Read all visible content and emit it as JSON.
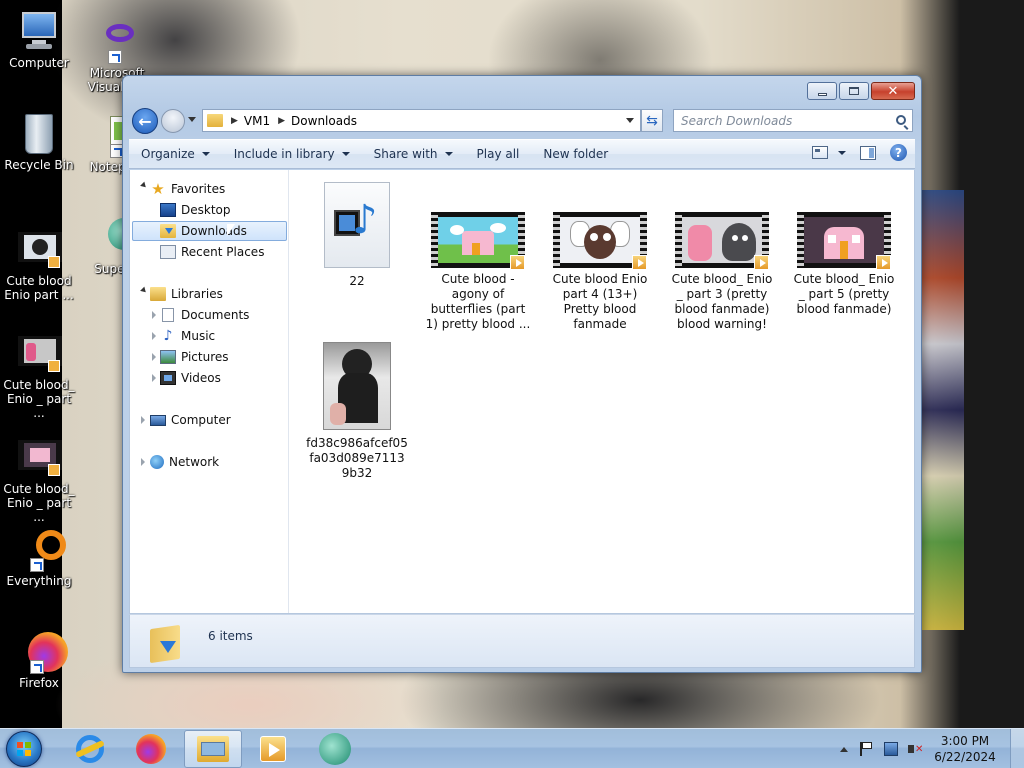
{
  "desktop": {
    "icons": [
      {
        "label": "Computer"
      },
      {
        "label": "Microsoft Visual S..."
      },
      {
        "label": "Recycle Bin"
      },
      {
        "label": "Notepa..."
      },
      {
        "label": "Cute blood Enio part ..."
      },
      {
        "label": "Super..."
      },
      {
        "label": "Cute blood_ Enio _ part ..."
      },
      {
        "label": "Cute blood_ Enio _ part ..."
      },
      {
        "label": "Everything"
      },
      {
        "label": "Firefox"
      }
    ]
  },
  "explorer": {
    "breadcrumb": [
      "VM1",
      "Downloads"
    ],
    "search_placeholder": "Search Downloads",
    "toolbar": {
      "organize": "Organize",
      "include_in_library": "Include in library",
      "share_with": "Share with",
      "play_all": "Play all",
      "new_folder": "New folder",
      "help": "?"
    },
    "nav": {
      "favorites": "Favorites",
      "desktop": "Desktop",
      "downloads": "Downloads",
      "recent_places": "Recent Places",
      "libraries": "Libraries",
      "documents": "Documents",
      "music": "Music",
      "pictures": "Pictures",
      "videos": "Videos",
      "computer": "Computer",
      "network": "Network"
    },
    "files": [
      {
        "name": "22",
        "kind": "media-file-icon"
      },
      {
        "name": "Cute blood - agony of butterflies (part 1) pretty blood ...",
        "kind": "video-thumbnail"
      },
      {
        "name": "Cute blood Enio part 4 (13+) Pretty blood fanmade",
        "kind": "video-thumbnail"
      },
      {
        "name": "Cute blood_ Enio _ part 3 (pretty blood fanmade) blood warning!",
        "kind": "video-thumbnail"
      },
      {
        "name": "Cute blood_ Enio _ part 5 (pretty blood fanmade)",
        "kind": "video-thumbnail"
      },
      {
        "name": "fd38c986afcef05fa03d089e71139b32",
        "kind": "photo-thumbnail"
      }
    ],
    "status": {
      "item_count": "6 items"
    }
  },
  "taskbar": {
    "clock_time": "3:00 PM",
    "clock_date": "6/22/2024"
  },
  "colors": {
    "window_frame": "#b3c9e4",
    "selection": "#cfe3fb",
    "taskbar": "#a7c3e2",
    "close_button": "#c7412c"
  }
}
